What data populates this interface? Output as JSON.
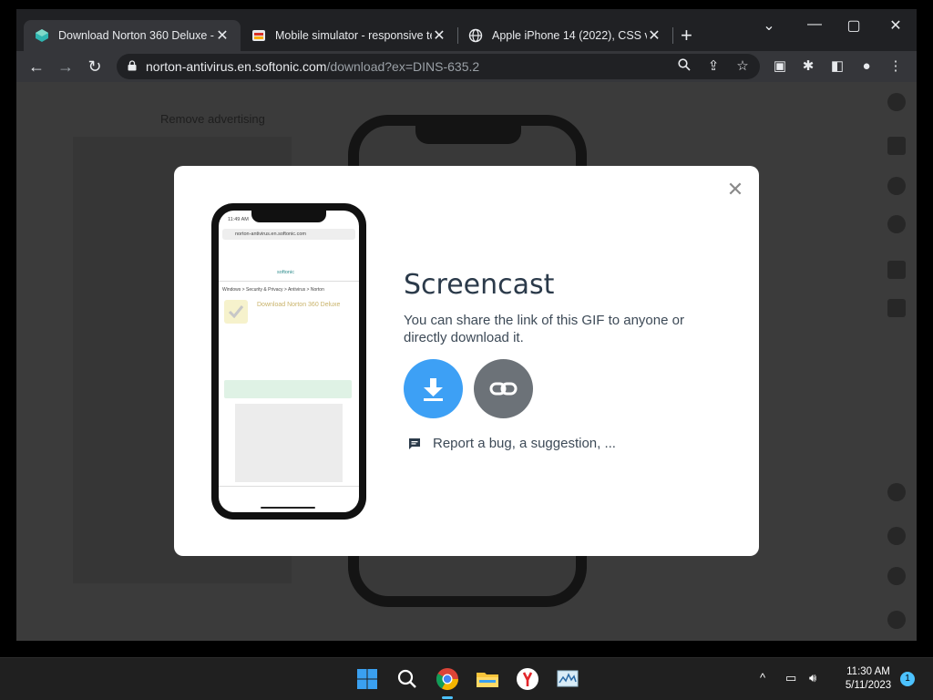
{
  "tabs": [
    {
      "title": "Download Norton 360 Deluxe - f",
      "active": true,
      "favicon": "softonic-icon"
    },
    {
      "title": "Mobile simulator - responsive te",
      "active": false,
      "favicon": "mobile-simulator-icon"
    },
    {
      "title": "Apple iPhone 14 (2022), CSS vie",
      "active": false,
      "favicon": "globe-icon"
    }
  ],
  "address": {
    "domain": "norton-antivirus.en.softonic.com",
    "path": "/download?ex=DINS-635.2"
  },
  "page": {
    "remove_ad": "Remove advertising"
  },
  "modal": {
    "title": "Screencast",
    "description": "You can share the link of this GIF to anyone or directly download it.",
    "report": "Report a bug, a suggestion, ..."
  },
  "preview": {
    "time": "11:49 AM",
    "url": "norton-antivirus.en.softonic.com",
    "logo": "softonic",
    "breadcrumb": "Windows > Security & Privacy > Antivirus > Norton",
    "product": "Download Norton 360 Deluxe"
  },
  "taskbar": {
    "time": "11:30 AM",
    "date": "5/11/2023",
    "notifications": "1"
  },
  "colors": {
    "download_button": "#3da0f5",
    "link_button": "#6c7278",
    "accent": "#4cc2ff"
  }
}
